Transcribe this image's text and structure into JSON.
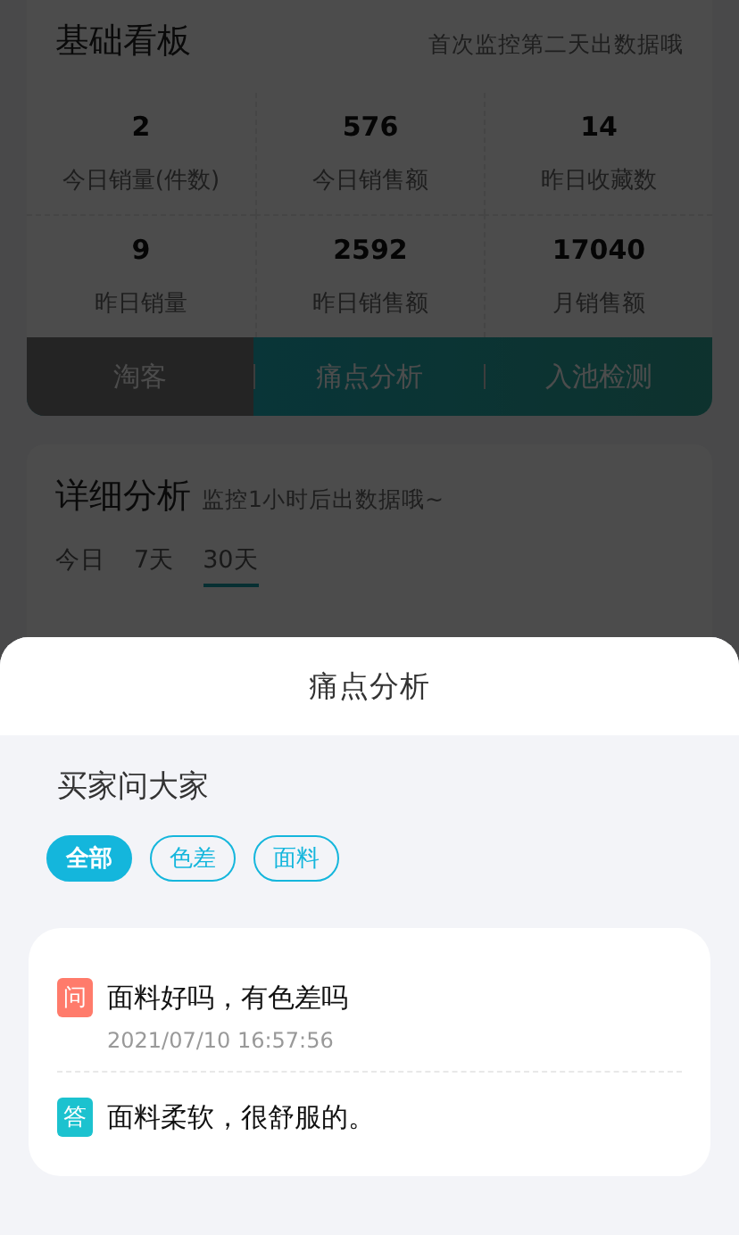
{
  "dashboard": {
    "title": "基础看板",
    "note": "首次监控第二天出数据哦",
    "stats": [
      {
        "value": "2",
        "label": "今日销量(件数)"
      },
      {
        "value": "576",
        "label": "今日销售额"
      },
      {
        "value": "14",
        "label": "昨日收藏数"
      },
      {
        "value": "9",
        "label": "昨日销量"
      },
      {
        "value": "2592",
        "label": "昨日销售额"
      },
      {
        "value": "17040",
        "label": "月销售额"
      }
    ],
    "tabs": [
      {
        "label": "淘客",
        "selected": true
      },
      {
        "label": "痛点分析",
        "selected": false
      },
      {
        "label": "入池检测",
        "selected": false
      }
    ]
  },
  "detail": {
    "title": "详细分析",
    "note": "监控1小时后出数据哦~",
    "periods": [
      {
        "label": "今日",
        "selected": false
      },
      {
        "label": "7天",
        "selected": false
      },
      {
        "label": "30天",
        "selected": true
      }
    ]
  },
  "sheet": {
    "title": "痛点分析",
    "section": "买家问大家",
    "filters": [
      {
        "label": "全部",
        "selected": true
      },
      {
        "label": "色差",
        "selected": false
      },
      {
        "label": "面料",
        "selected": false
      }
    ],
    "qa": [
      {
        "kind": "question",
        "badge": "问",
        "text": "面料好吗，有色差吗",
        "time": "2021/07/10 16:57:56"
      },
      {
        "kind": "answer",
        "badge": "答",
        "text": "面料柔软，很舒服的。"
      }
    ]
  }
}
